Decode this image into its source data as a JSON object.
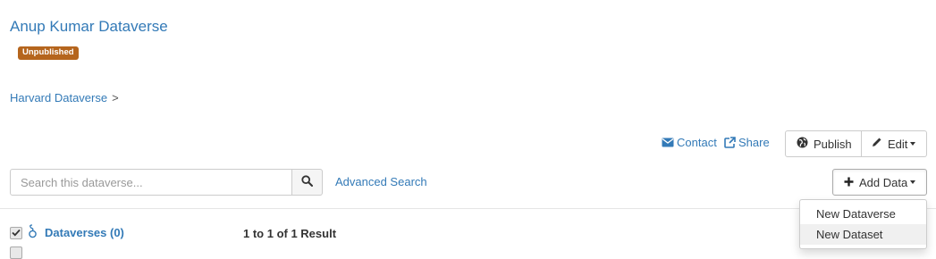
{
  "header": {
    "title": "Anup Kumar Dataverse",
    "status_badge": "Unpublished",
    "badge_color": "#b5651d",
    "link_color": "#337ab7"
  },
  "breadcrumb": {
    "items": [
      "Harvard Dataverse"
    ],
    "separator": ">"
  },
  "actions": {
    "contact_label": "Contact",
    "share_label": "Share",
    "publish_label": "Publish",
    "edit_label": "Edit"
  },
  "search": {
    "placeholder": "Search this dataverse...",
    "value": "",
    "advanced_label": "Advanced Search"
  },
  "add_data": {
    "label": "Add Data",
    "menu": [
      "New Dataverse",
      "New Dataset"
    ],
    "highlighted": "New Dataset"
  },
  "facets": {
    "dataverses_label": "Dataverses (0)",
    "dataverses_checked": true
  },
  "results": {
    "summary": "1 to 1 of 1 Result"
  }
}
